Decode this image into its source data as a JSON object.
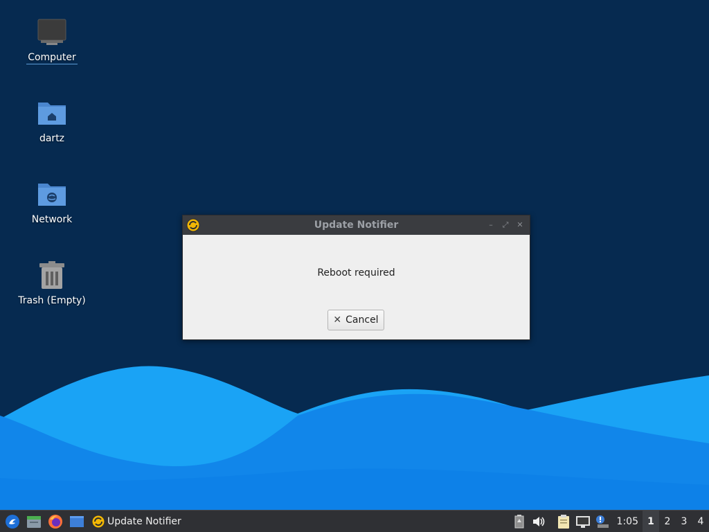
{
  "desktop": {
    "icons": [
      {
        "label": "Computer",
        "icon": "computer-icon"
      },
      {
        "label": "dartz",
        "icon": "home-folder-icon"
      },
      {
        "label": "Network",
        "icon": "network-folder-icon"
      },
      {
        "label": "Trash (Empty)",
        "icon": "trash-icon"
      }
    ]
  },
  "dialog": {
    "title": "Update Notifier",
    "message": "Reboot required",
    "cancel_label": "Cancel",
    "controls": {
      "minimize": "–",
      "maximize": "⤢",
      "close": "✕"
    }
  },
  "taskbar": {
    "launchers": [
      "start-menu-icon",
      "file-manager-icon",
      "firefox-icon",
      "show-desktop-icon"
    ],
    "task_label": "Update Notifier",
    "tray": [
      "battery-icon",
      "volume-icon",
      "clipboard-icon",
      "network-icon",
      "update-notifier-icon"
    ],
    "clock": "1:05",
    "workspaces": [
      "1",
      "2",
      "3",
      "4"
    ],
    "active_workspace": "1"
  },
  "colors": {
    "background": "#062a50",
    "wave_light": "#1aa3f5",
    "wave_mid": "#1186ea",
    "wave_dark": "#0b6fd9",
    "taskbar": "#2f3034",
    "dialog_title_bar": "#3a3c40"
  }
}
